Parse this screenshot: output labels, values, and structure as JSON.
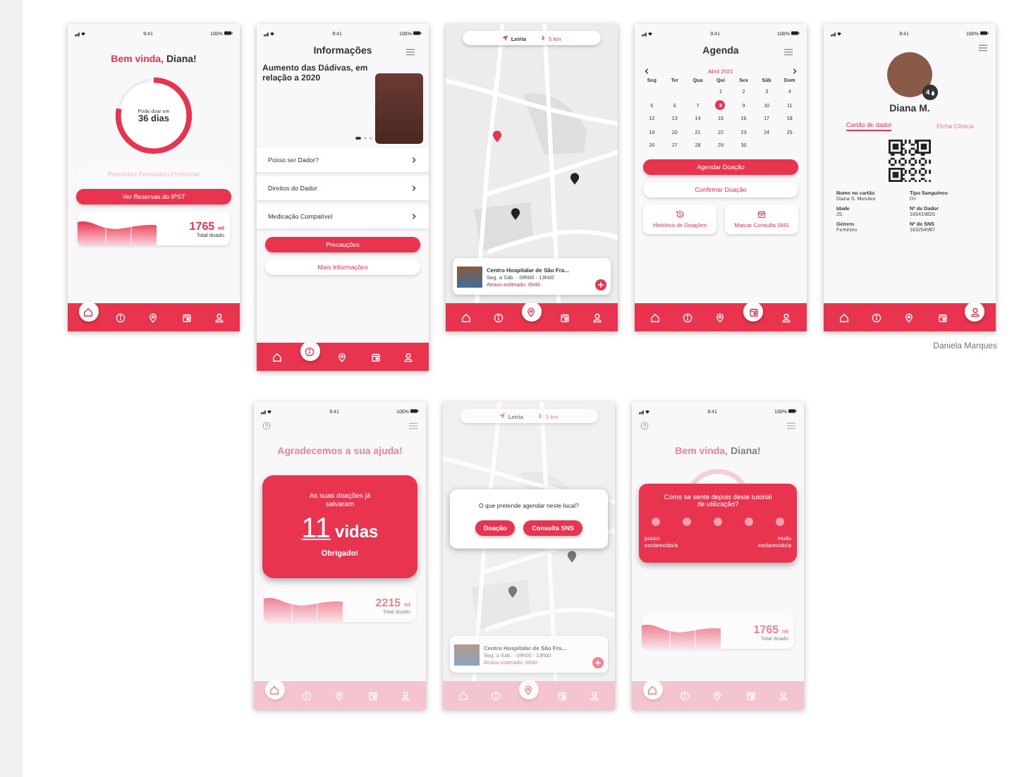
{
  "rows": [
    {
      "screens": [
        {
          "kind": "home",
          "dimmed": false,
          "status": {
            "time": "9:41",
            "battery": "100%"
          },
          "greeting": {
            "accent": "Bem vinda,",
            "name": "Diana!"
          },
          "ring": {
            "caption": "Pode doar em",
            "value": "36 dias",
            "level": 0.78
          },
          "form_button": {
            "label": "Preencher Formulário Preliminar",
            "disabled": true
          },
          "primary_button": "Ver Reservas do IPST",
          "total": {
            "amount": "1765",
            "unit": "ml",
            "caption": "Total doado"
          },
          "nav": [
            {
              "selected": true
            },
            {
              "selected": false
            },
            {
              "selected": false
            },
            {
              "selected": false
            },
            {
              "selected": false
            }
          ]
        },
        {
          "kind": "info",
          "dimmed": false,
          "status": {
            "time": "9:41",
            "battery": "100%"
          },
          "title": "Informações",
          "banner": {
            "headline": "Aumento das Dádivas, em relação a 2020",
            "dots": [
              {
                "selected": true
              },
              {
                "selected": false
              },
              {
                "selected": false
              }
            ]
          },
          "links": [
            "Posso ser Dador?",
            "Direitos do Dador",
            "Medicação Compatível"
          ],
          "primary_button": "Precauções",
          "secondary_button": "Mais Informações",
          "nav": [
            {
              "selected": false
            },
            {
              "selected": true
            },
            {
              "selected": false
            },
            {
              "selected": false
            },
            {
              "selected": false
            }
          ]
        },
        {
          "kind": "map",
          "dimmed": false,
          "search": {
            "location": "Leiria",
            "radius": "5 km"
          },
          "card": {
            "name": "Centro Hospitalar de São Fra...",
            "hours": "Seg. a Sáb. · 09h00 - 13h00",
            "delay": "Atraso estimado: 0h40"
          },
          "nav": [
            {
              "selected": false
            },
            {
              "selected": false
            },
            {
              "selected": true
            },
            {
              "selected": false
            },
            {
              "selected": false
            }
          ]
        },
        {
          "kind": "agenda",
          "dimmed": false,
          "status": {
            "time": "9:41",
            "battery": "100%"
          },
          "title": "Agenda",
          "month": "Abril 2021",
          "weekdays": [
            "Seg",
            "Ter",
            "Qua",
            "Qui",
            "Sex",
            "Sáb",
            "Dom"
          ],
          "weeks": [
            [
              {
                "day": "1",
                "selected": false
              },
              {
                "day": "2",
                "selected": false
              },
              {
                "day": "3",
                "selected": false
              },
              {
                "day": "4",
                "selected": false
              }
            ],
            [
              {
                "day": "5",
                "selected": false
              },
              {
                "day": "6",
                "selected": false
              },
              {
                "day": "7",
                "selected": false
              },
              {
                "day": "8",
                "selected": true
              },
              {
                "day": "9",
                "selected": false
              },
              {
                "day": "10",
                "selected": false
              },
              {
                "day": "11",
                "selected": false
              }
            ],
            [
              {
                "day": "12",
                "selected": false
              },
              {
                "day": "13",
                "selected": false
              },
              {
                "day": "14",
                "selected": false
              },
              {
                "day": "15",
                "selected": false
              },
              {
                "day": "16",
                "selected": false
              },
              {
                "day": "17",
                "selected": false
              },
              {
                "day": "18",
                "selected": false
              }
            ],
            [
              {
                "day": "19",
                "selected": false
              },
              {
                "day": "20",
                "selected": false
              },
              {
                "day": "21",
                "selected": false
              },
              {
                "day": "22",
                "selected": false
              },
              {
                "day": "23",
                "selected": false
              },
              {
                "day": "24",
                "selected": false
              },
              {
                "day": "25",
                "selected": false
              }
            ],
            [
              {
                "day": "26",
                "selected": false
              },
              {
                "day": "27",
                "selected": false
              },
              {
                "day": "28",
                "selected": false
              },
              {
                "day": "29",
                "selected": false
              },
              {
                "day": "30",
                "selected": false
              }
            ]
          ],
          "primary_button": "Agendar Doação",
          "secondary_button": "Confirmar Doação",
          "tiles": [
            "Histórico de Doações",
            "Marcar Consulta SNS"
          ],
          "nav": [
            {
              "selected": false
            },
            {
              "selected": false
            },
            {
              "selected": false
            },
            {
              "selected": true
            },
            {
              "selected": false
            }
          ]
        },
        {
          "kind": "profile",
          "dimmed": false,
          "status": {
            "time": "9:41",
            "battery": "100%"
          },
          "badge": "4",
          "name": "Diana M.",
          "tabs": [
            {
              "label": "Cartão de dador",
              "selected": true
            },
            {
              "label": "Ficha Clínica",
              "selected": false
            }
          ],
          "fields": [
            {
              "label": "Nome no cartão",
              "value": "Diana S. Mendes"
            },
            {
              "label": "Tipo Sanguíneo",
              "value": "O+"
            },
            {
              "label": "Idade",
              "value": "25"
            },
            {
              "label": "Nº de Dador",
              "value": "165419825"
            },
            {
              "label": "Género",
              "value": "Feminino"
            },
            {
              "label": "Nº de SNS",
              "value": "163254987"
            }
          ],
          "nav": [
            {
              "selected": false
            },
            {
              "selected": false
            },
            {
              "selected": false
            },
            {
              "selected": false
            },
            {
              "selected": true
            }
          ]
        }
      ]
    },
    {
      "screens": [
        {
          "kind": "thanks",
          "dimmed": true,
          "status": {
            "time": "9:41",
            "battery": "100%"
          },
          "title": "Agradecemos a sua ajuda!",
          "card": {
            "intro": "As suas doações já salvaram",
            "count": "11",
            "unit": "vidas",
            "closing": "Obrigado!"
          },
          "total": {
            "amount": "2215",
            "unit": "ml",
            "caption": "Total doado"
          },
          "nav": [
            {
              "selected": true
            },
            {
              "selected": false
            },
            {
              "selected": false
            },
            {
              "selected": false
            },
            {
              "selected": false
            }
          ]
        },
        {
          "kind": "map",
          "dimmed": true,
          "search": {
            "location": "Leiria",
            "radius": "5 km"
          },
          "dialog": {
            "question": "O que pretende agendar neste local?",
            "buttons": [
              "Doação",
              "Consulta SNS"
            ]
          },
          "card": {
            "name": "Centro Hospitalar de São Fra...",
            "hours": "Seg. a Sáb. · 09h00 - 13h00",
            "delay": "Atraso estimado: 0h40"
          },
          "nav": [
            {
              "selected": false
            },
            {
              "selected": false
            },
            {
              "selected": true
            },
            {
              "selected": false
            },
            {
              "selected": false
            }
          ]
        },
        {
          "kind": "survey",
          "dimmed": true,
          "status": {
            "time": "9:41",
            "battery": "100%"
          },
          "greeting": {
            "accent": "Bem vinda,",
            "name": "Diana!"
          },
          "dialog": {
            "question": "Como se sente depois deste tutorial de utilização?",
            "options": [
              {
                "selected": false
              },
              {
                "selected": false
              },
              {
                "selected": false
              },
              {
                "selected": false
              },
              {
                "selected": false
              }
            ],
            "low_label": "pouco esclarecido/a",
            "high_label": "muito esclarecido/a"
          },
          "total": {
            "amount": "1765",
            "unit": "ml",
            "caption": "Total doado"
          },
          "nav": [
            {
              "selected": true
            },
            {
              "selected": false
            },
            {
              "selected": false
            },
            {
              "selected": false
            },
            {
              "selected": false
            }
          ]
        }
      ]
    }
  ],
  "author": "Daniela Marques"
}
